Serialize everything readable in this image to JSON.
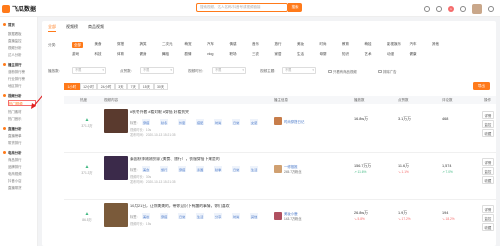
{
  "app": {
    "logo_text": "飞瓜数据",
    "search_placeholder": "搜索视频、达人名称/抖音号或视频链接",
    "search_button": "搜索",
    "notify_count": "1"
  },
  "sidebar": {
    "items": [
      {
        "label": "首页",
        "kind": "group"
      },
      {
        "label": "数据看板",
        "kind": "sub"
      },
      {
        "label": "直播监控",
        "kind": "sub"
      },
      {
        "label": "视频分析",
        "kind": "sub"
      },
      {
        "label": "达人分析",
        "kind": "sub"
      },
      {
        "label": "播主排行",
        "kind": "group"
      },
      {
        "label": "涨粉排行榜",
        "kind": "sub"
      },
      {
        "label": "行业排行榜",
        "kind": "sub"
      },
      {
        "label": "地区排行",
        "kind": "sub"
      },
      {
        "label": "视频分析",
        "kind": "group"
      },
      {
        "label": "热门视频",
        "kind": "active"
      },
      {
        "label": "热门素材",
        "kind": "sub"
      },
      {
        "label": "热门音乐",
        "kind": "sub"
      },
      {
        "label": "直播分析",
        "kind": "group"
      },
      {
        "label": "直播榜单",
        "kind": "sub"
      },
      {
        "label": "带货排行",
        "kind": "sub"
      },
      {
        "label": "电商分析",
        "kind": "group"
      },
      {
        "label": "商品排行",
        "kind": "sub"
      },
      {
        "label": "品牌排行",
        "kind": "sub"
      },
      {
        "label": "电商视频",
        "kind": "sub"
      },
      {
        "label": "抖音小店",
        "kind": "sub"
      },
      {
        "label": "直播带货",
        "kind": "sub"
      }
    ]
  },
  "filters": {
    "tabs": [
      "全部",
      "视频榜",
      "商品视频"
    ],
    "category_label": "分类:",
    "categories_row1": [
      "全部",
      "美食",
      "穿搭",
      "搞笑",
      "二次元",
      "萌宠",
      "汽车",
      "情感",
      "音乐",
      "旅行",
      "美妆",
      "时尚",
      "教育",
      "萌娃",
      "影视娱乐",
      "汽车",
      "其他"
    ],
    "categories_row2": [
      "游戏",
      "科技",
      "体育",
      "健身",
      "舞蹈",
      "剧情",
      "vlog",
      "职场",
      "三农",
      "家居",
      "生活",
      "母婴",
      "知识",
      "艺术",
      "动漫",
      "健康"
    ],
    "f1_label": "播放数:",
    "f1_value": "不限",
    "f2_label": "点赞数:",
    "f2_value": "不限",
    "f3_label": "视频时长:",
    "f3_value": "不限",
    "f4_label": "视频主题:",
    "f4_value": "不限",
    "chk1": "只看有商品视频",
    "chk2": "排除广告",
    "time_tabs": [
      "1小时",
      "12小时",
      "24小时",
      "3天",
      "7天",
      "15天",
      "30天"
    ],
    "export": "导出"
  },
  "table": {
    "headers": [
      "热度",
      "视频内容",
      "播主信息",
      "播放数",
      "点赞数",
      "评论数",
      "操作"
    ],
    "rows": [
      {
        "rank_val": "371.3万",
        "title": "#秋冬外套 #看对眼 #穿搭 好看到哭",
        "tags": [
          "穿搭",
          "秋冬",
          "外套",
          "搭配",
          "时尚",
          "日常",
          "女装"
        ],
        "meta1": "视频时长：10s",
        "meta2": "发布时间：2020-10-13 15:21:35",
        "author": "时尚穿搭日记",
        "author_sub": "",
        "plays": "16.8w万",
        "plays_d": "",
        "likes": "3.1万万",
        "likes_d": "",
        "comments": "468",
        "comments_d": "",
        "ops": [
          "详情",
          "监控",
          "收藏"
        ]
      },
      {
        "rank_val": "371.3万",
        "title": "泰国秋季刚刚到家 (美食、旅行），衣服穿搭下来是的",
        "tags": [
          "美食",
          "旅行",
          "穿搭",
          "泰国",
          "秋季",
          "日常",
          "生活"
        ],
        "meta1": "视频时长：30s",
        "meta2": "发布时间：2020-10-13 15:21:35",
        "author": "一修推推",
        "author_sub": "245.7万粉丝",
        "plays": "156.7万万",
        "plays_d": "↗ 11.6%",
        "likes": "11.6万",
        "likes_d": "↘ 1.1%",
        "comments": "1,574",
        "comments_d": "↗ 7.0%",
        "ops": [
          "详情",
          "监控",
          "收藏"
        ]
      },
      {
        "rank_val": "86.5万",
        "title": "10月21日，让你美美的，带你见识下有趣的事情，你们喜欢",
        "tags": [
          "美妆",
          "穿搭",
          "日常",
          "生活",
          "分享",
          "时尚",
          "其他"
        ],
        "meta1": "视频时长：15s",
        "meta2": "",
        "author": "美妆小鹿",
        "author_sub": "143.7万粉丝",
        "plays": "26.8w万",
        "plays_d": "↘ 5.8%",
        "likes": "1.9万",
        "likes_d": "↘ 17.2%",
        "comments": "194",
        "comments_d": "↘ 18.2%",
        "ops": [
          "详情",
          "监控",
          "收藏"
        ]
      }
    ]
  },
  "colors": {
    "accent": "#ff7a1a",
    "up": "#42b983",
    "down": "#f56c6c",
    "link": "#4a79c9"
  }
}
